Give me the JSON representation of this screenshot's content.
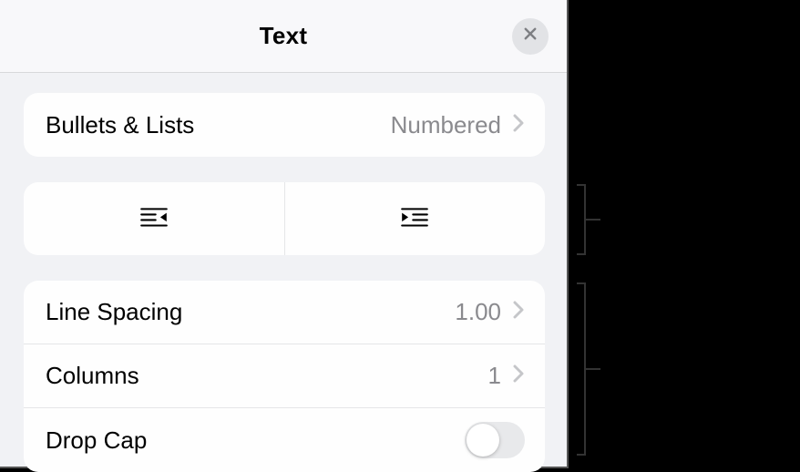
{
  "header": {
    "title": "Text"
  },
  "bullets": {
    "label": "Bullets & Lists",
    "value": "Numbered"
  },
  "spacing": {
    "line_spacing_label": "Line Spacing",
    "line_spacing_value": "1.00",
    "columns_label": "Columns",
    "columns_value": "1",
    "drop_cap_label": "Drop Cap"
  }
}
